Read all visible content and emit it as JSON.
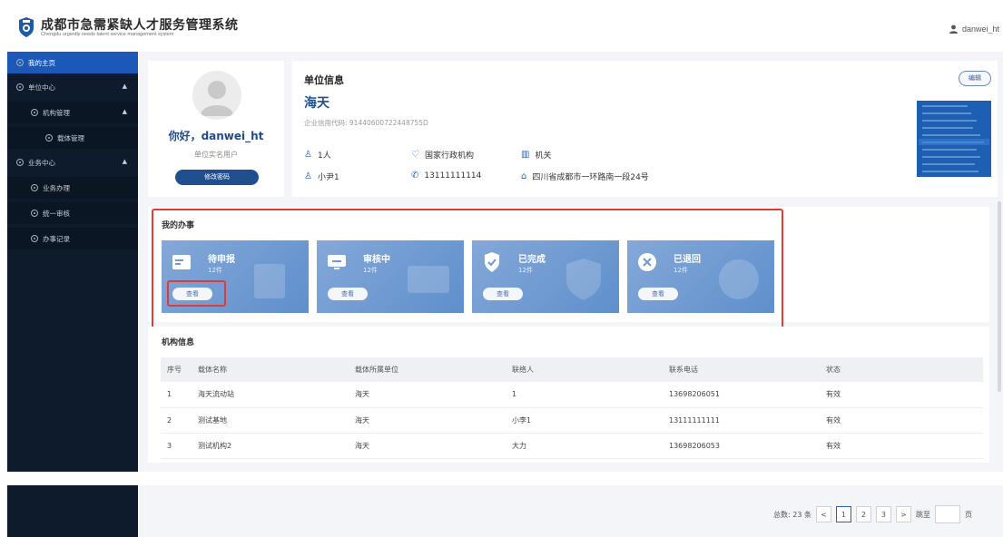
{
  "header": {
    "title": "成都市急需紧缺人才服务管理系统",
    "subtitle": "Chengdu urgently needs talent service management system",
    "username": "danwei_ht"
  },
  "sidebar": {
    "items": [
      {
        "label": "我的主页"
      },
      {
        "label": "单位中心"
      },
      {
        "label": "机构管理"
      },
      {
        "label": "载体管理"
      },
      {
        "label": "业务中心"
      },
      {
        "label": "业务办理"
      },
      {
        "label": "统一审核"
      },
      {
        "label": "办事记录"
      }
    ]
  },
  "profile": {
    "greeting": "你好，danwei_ht",
    "role": "单位实名用户",
    "change_password": "修改密码"
  },
  "unit": {
    "section_title": "单位信息",
    "name": "海天",
    "credit_code": "企业信用代码: 91440600722448755D",
    "people": "1人",
    "org_type": "国家行政机构",
    "category": "机关",
    "contact": "小尹1",
    "phone": "13111111114",
    "address": "四川省成都市一环路南一段24号",
    "edit": "编辑"
  },
  "tasks": {
    "title": "我的办事",
    "items": [
      {
        "label": "待申报",
        "count": "12件",
        "button": "查看"
      },
      {
        "label": "审核中",
        "count": "12件",
        "button": "查看"
      },
      {
        "label": "已完成",
        "count": "12件",
        "button": "查看"
      },
      {
        "label": "已退回",
        "count": "12件",
        "button": "查看"
      }
    ]
  },
  "org_table": {
    "title": "机构信息",
    "columns": [
      "序号",
      "载体名称",
      "载体所属单位",
      "联络人",
      "联系电话",
      "状态"
    ],
    "rows": [
      [
        "1",
        "海天流动站",
        "海天",
        "1",
        "13698206051",
        "有效"
      ],
      [
        "2",
        "测试基地",
        "海天",
        "小李1",
        "13111111111",
        "有效"
      ],
      [
        "3",
        "测试机构2",
        "海天",
        "大力",
        "13698206053",
        "有效"
      ]
    ]
  },
  "pagination": {
    "total": "总数: 23 条",
    "prev": "<",
    "pages": [
      "1",
      "2",
      "3"
    ],
    "next": ">",
    "goto": "跳至",
    "page_unit": "页"
  },
  "colors": {
    "sidebar_bg": "#0e1b2d",
    "active_nav": "#1b58b8",
    "brand_blue": "#1f4f8f",
    "task_card": "#6f9ad2",
    "highlight": "#e23b35"
  }
}
